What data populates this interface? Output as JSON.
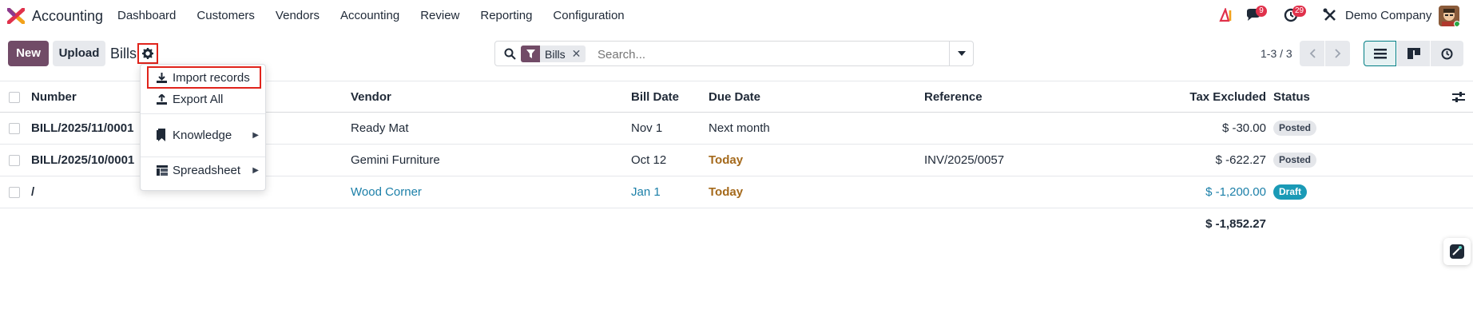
{
  "nav": {
    "app_name": "Accounting",
    "menu": [
      "Dashboard",
      "Customers",
      "Vendors",
      "Accounting",
      "Review",
      "Reporting",
      "Configuration"
    ],
    "messages_count": "9",
    "activities_count": "29",
    "company": "Demo Company"
  },
  "control": {
    "new_label": "New",
    "upload_label": "Upload",
    "title": "Bills",
    "search_facet": "Bills",
    "search_placeholder": "Search...",
    "pager": "1-3 / 3"
  },
  "dropdown": {
    "items": [
      {
        "label": "Import records",
        "icon": "download-icon"
      },
      {
        "label": "Export All",
        "icon": "upload-icon"
      },
      {
        "label": "Knowledge",
        "icon": "bookmark-icon"
      },
      {
        "label": "Spreadsheet",
        "icon": "spreadsheet-icon"
      }
    ]
  },
  "table": {
    "headers": {
      "number": "Number",
      "vendor": "Vendor",
      "bill_date": "Bill Date",
      "due_date": "Due Date",
      "reference": "Reference",
      "tax_excluded": "Tax Excluded",
      "status": "Status"
    },
    "rows": [
      {
        "number": "BILL/2025/11/0001",
        "vendor": "Ready Mat",
        "bill_date": "Nov 1",
        "due_date": "Next month",
        "reference": "",
        "amount": "$ -30.00",
        "status": "Posted"
      },
      {
        "number": "BILL/2025/10/0001",
        "vendor": "Gemini Furniture",
        "bill_date": "Oct 12",
        "due_date": "Today",
        "reference": "INV/2025/0057",
        "amount": "$ -622.27",
        "status": "Posted"
      },
      {
        "number": "/",
        "vendor": "Wood Corner",
        "bill_date": "Jan 1",
        "due_date": "Today",
        "reference": "",
        "amount": "$ -1,200.00",
        "status": "Draft"
      }
    ],
    "total": "$ -1,852.27"
  },
  "colors": {
    "brand": "#714b67",
    "draft": "#1a9ab6",
    "due_today": "#a4691b",
    "highlight": "#e0231b"
  }
}
